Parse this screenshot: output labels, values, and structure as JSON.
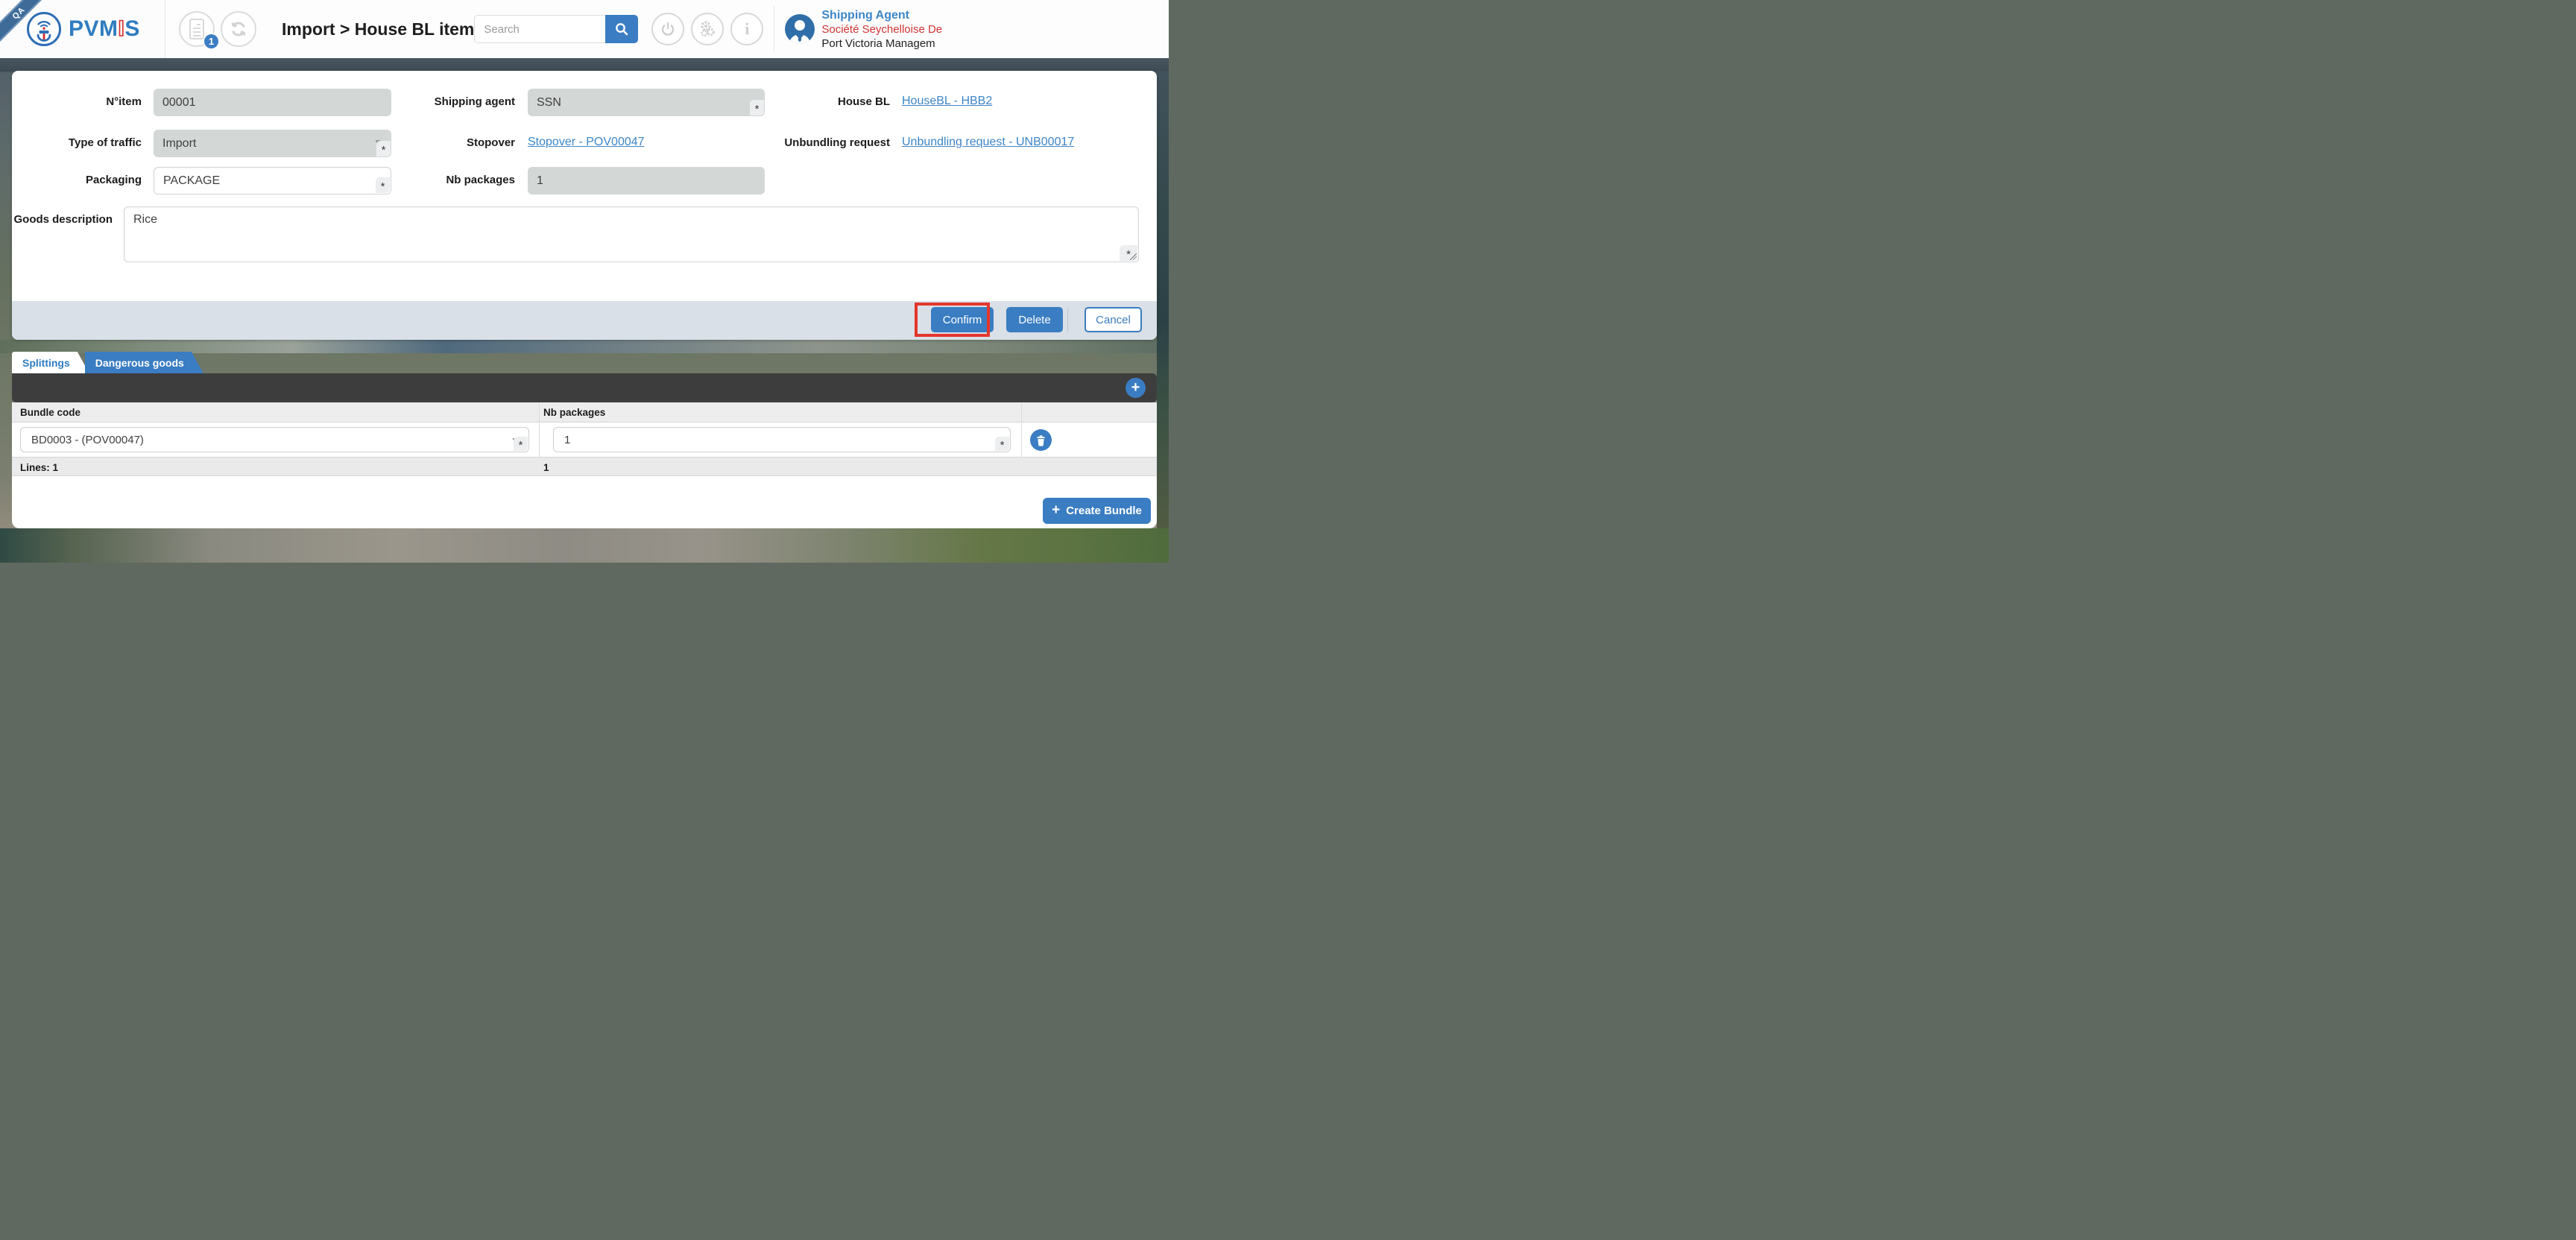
{
  "header": {
    "qa_label": "QA",
    "brand": {
      "prefix": "PVM",
      "mid": "I",
      "suffix": "S"
    },
    "notifications_count": "1",
    "title": "Import > House BL item",
    "search": {
      "placeholder": "Search"
    },
    "user": {
      "role": "Shipping Agent",
      "company": "Société Seychelloise De",
      "org": "Port Victoria Managem"
    }
  },
  "form": {
    "n_item": {
      "label": "N°item",
      "value": "00001"
    },
    "type_of_traffic": {
      "label": "Type of traffic",
      "value": "Import"
    },
    "packaging": {
      "label": "Packaging",
      "value": "PACKAGE"
    },
    "shipping_agent": {
      "label": "Shipping agent",
      "value": "SSN"
    },
    "stopover": {
      "label": "Stopover",
      "link": "Stopover - POV00047"
    },
    "nb_packages": {
      "label": "Nb packages",
      "value": "1"
    },
    "house_bl": {
      "label": "House BL",
      "link": "HouseBL - HBB2"
    },
    "unbundling_request": {
      "label": "Unbundling request",
      "link": "Unbundling request - UNB00017"
    },
    "goods_description": {
      "label": "Goods description",
      "value": "Rice"
    }
  },
  "actions": {
    "confirm": "Confirm",
    "delete": "Delete",
    "cancel": "Cancel"
  },
  "tabs": [
    {
      "label": "Splittings",
      "active": true
    },
    {
      "label": "Dangerous goods",
      "active": false
    }
  ],
  "splittings": {
    "columns": [
      "Bundle code",
      "Nb packages"
    ],
    "row": {
      "bundle_code": "BD0003 - (POV00047)",
      "nb_packages": "1"
    },
    "summary": {
      "lines": "Lines: 1",
      "nb_total": "1"
    },
    "create_bundle": "Create Bundle"
  },
  "icons": {
    "plus": "+",
    "dropdown_arrow": "▼",
    "required": "*",
    "info": "i"
  },
  "colors": {
    "accent": "#3a7dc2",
    "link": "#3d85c6",
    "highlight_red": "#e5352b",
    "toolbar_dark": "#3d3d3d",
    "footer_bar": "#d9e0e7"
  }
}
